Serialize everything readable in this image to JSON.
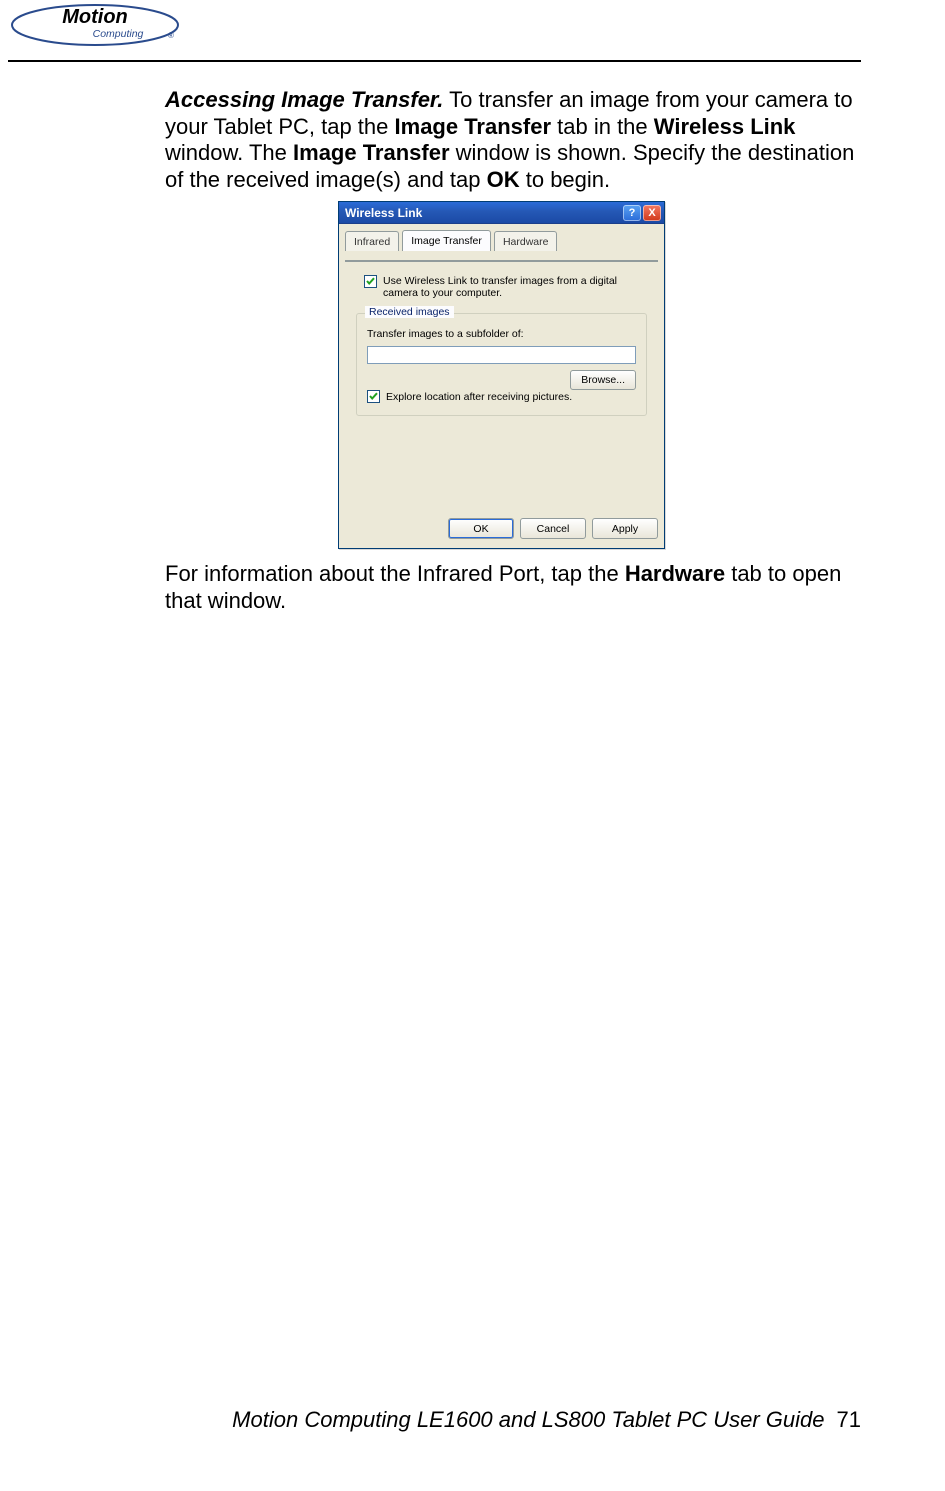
{
  "header": {
    "brand_main": "Motion",
    "brand_sub": "Computing",
    "brand_reg": "®"
  },
  "body": {
    "p1_lead": "Accessing Image Transfer.",
    "p1_a": "  To transfer an image from your camera to your Tablet PC, tap the ",
    "p1_b1": "Image Transfer",
    "p1_b": " tab in the ",
    "p1_b2": "Wireless Link",
    "p1_c": " window. The ",
    "p1_b3": "Image Transfer",
    "p1_d": " window is shown. Specify the destination of the received image(s) and tap ",
    "p1_b4": "OK",
    "p1_e": " to begin.",
    "p2_a": "For information about the Infrared Port, tap the ",
    "p2_b1": "Hardware",
    "p2_b": " tab to open that window."
  },
  "dialog": {
    "title": "Wireless Link",
    "help": "?",
    "close": "X",
    "tabs": {
      "infrared": "Infrared",
      "image_transfer": "Image Transfer",
      "hardware": "Hardware"
    },
    "chk_use_wireless": "Use Wireless Link to transfer images from a digital camera to your computer.",
    "group_legend": "Received images",
    "transfer_label": "Transfer images to a subfolder of:",
    "path_value": "",
    "browse": "Browse...",
    "chk_explore": "Explore location after receiving pictures.",
    "ok": "OK",
    "cancel": "Cancel",
    "apply": "Apply"
  },
  "footer": {
    "title": "Motion Computing LE1600 and LS800 Tablet PC User Guide",
    "page": "71"
  }
}
